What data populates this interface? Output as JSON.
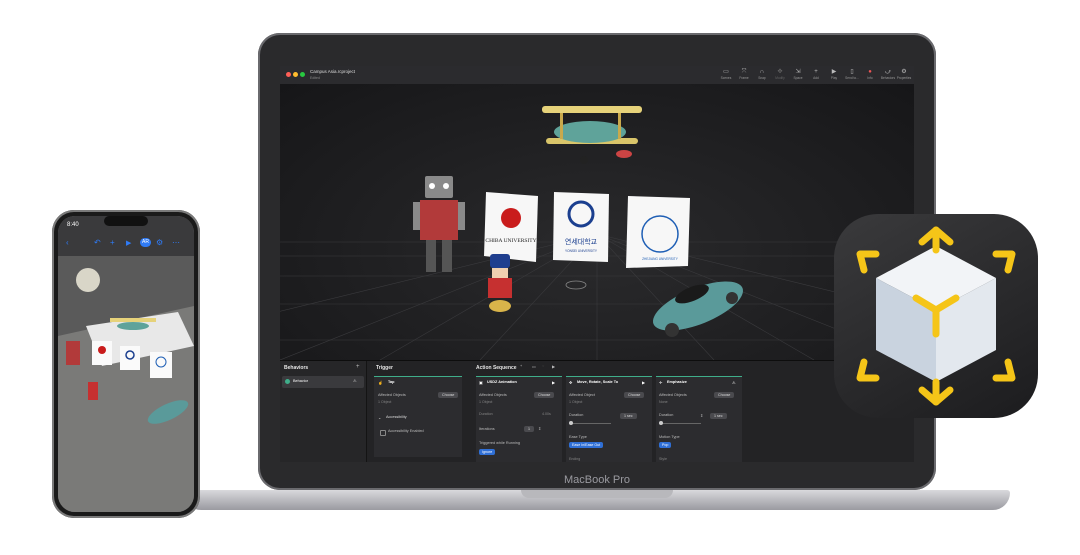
{
  "macbook": {
    "label": "MacBook Pro"
  },
  "reality_composer": {
    "project_title": "Campus Asia.rcproject",
    "project_subtitle": "Edited",
    "toolbar": [
      {
        "label": "Scenes",
        "icon": "scenes-icon"
      },
      {
        "label": "Frame",
        "icon": "frame-icon"
      },
      {
        "label": "Snap",
        "icon": "snap-icon"
      },
      {
        "label": "Modify",
        "icon": "modify-icon"
      },
      {
        "label": "Space",
        "icon": "space-icon"
      },
      {
        "label": "Add",
        "icon": "add-icon"
      },
      {
        "label": "Play",
        "icon": "play-icon"
      },
      {
        "label": "Send to...",
        "icon": "send-icon"
      },
      {
        "label": "Info",
        "icon": "info-icon"
      },
      {
        "label": "Behaviors",
        "icon": "behaviors-icon"
      },
      {
        "label": "Properties",
        "icon": "properties-icon"
      }
    ],
    "scene_signs": {
      "chiba": "CHIBA UNIVERSITY",
      "yonsei_kr": "연세대학교",
      "yonsei_en": "YONSEI UNIVERSITY",
      "zhejiang": "ZHEJIANG UNIVERSITY"
    },
    "behaviors": {
      "title": "Behaviors",
      "add": "+",
      "item": "Behavior",
      "warning": "⚠"
    },
    "trigger": {
      "title": "Trigger",
      "name": "Tap",
      "affected_label": "Affected Objects",
      "affected_value": "1 Object",
      "choose": "Choose",
      "accessibility": "Accessibility",
      "accessibility_enabled": "Accessibility Enabled"
    },
    "action_sequence": {
      "title": "Action Sequence",
      "actions": [
        {
          "name": "USDZ Animation",
          "affected_label": "Affected Objects",
          "affected_value": "1 Object",
          "choose": "Choose",
          "duration_label": "Duration",
          "duration_value": "4.00s",
          "iterations_label": "Iterations",
          "iterations_value": "1",
          "triggered_label": "Triggered while Running",
          "triggered_value": "Ignore"
        },
        {
          "name": "Move, Rotate, Scale To",
          "affected_label": "Affected Object",
          "affected_value": "1 Object",
          "choose": "Choose",
          "duration_label": "Duration",
          "duration_value": "1 sec",
          "ease_label": "Ease Type",
          "ease_value": "Ease In/Ease Out",
          "extra_label": "Ending"
        },
        {
          "name": "Emphasize",
          "affected_label": "Affected Objects",
          "affected_value": "None",
          "choose": "Choose",
          "duration_label": "Duration",
          "duration_value": "1 sec",
          "motion_label": "Motion Type",
          "motion_value": "Pop",
          "extra_label": "Style"
        }
      ]
    }
  },
  "iphone": {
    "time": "8:40",
    "toolbar_icons": [
      "back-icon",
      "undo-icon",
      "add-icon",
      "play-icon",
      "ar-icon",
      "settings-icon",
      "more-icon"
    ],
    "ar_label": "AR"
  },
  "app_icon": {
    "name": "reality-composer-app-icon"
  },
  "colors": {
    "accent_teal": "#3fae8a",
    "accent_blue": "#2f6fd6",
    "icon_yellow": "#f5c518"
  }
}
